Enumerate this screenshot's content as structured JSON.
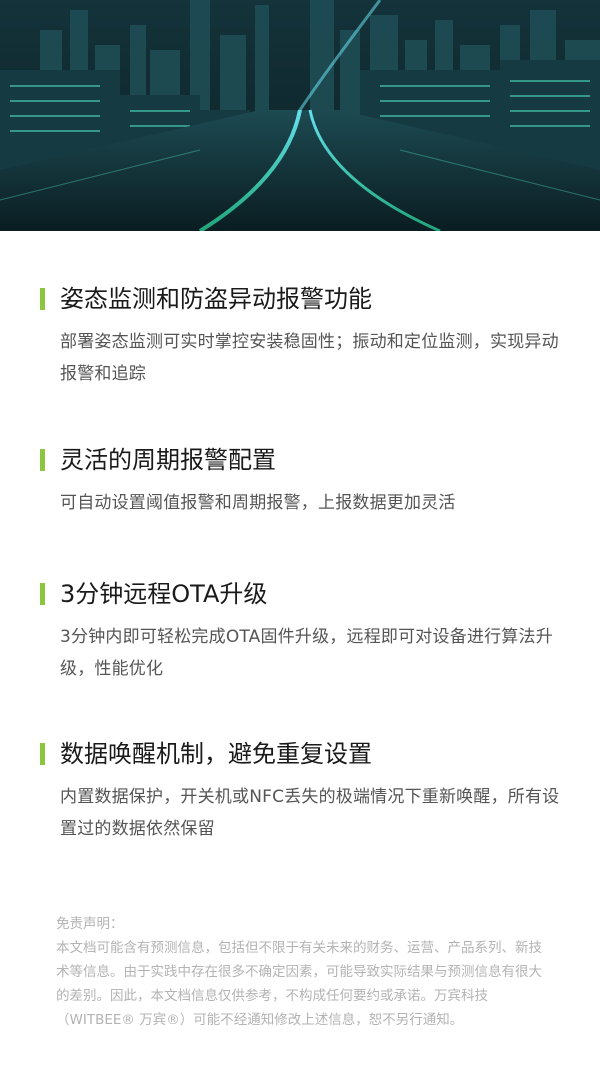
{
  "features": [
    {
      "title": "姿态监测和防盗异动报警功能",
      "description": "部署姿态监测可实时掌控安装稳固性；振动和定位监测，实现异动报警和追踪"
    },
    {
      "title": "灵活的周期报警配置",
      "description": "可自动设置阈值报警和周期报警，上报数据更加灵活"
    },
    {
      "title": "3分钟远程OTA升级",
      "description": "3分钟内即可轻松完成OTA固件升级，远程即可对设备进行算法升级，性能优化"
    },
    {
      "title": "数据唤醒机制，避免重复设置",
      "description": "内置数据保护，开关机或NFC丢失的极端情况下重新唤醒，所有设置过的数据依然保留"
    }
  ],
  "disclaimer": {
    "title": "免责声明：",
    "body": "本文档可能含有预测信息，包括但不限于有关未来的财务、运营、产品系列、新技术等信息。由于实践中存在很多不确定因素，可能导致实际结果与预测信息有很大的差别。因此，本文档信息仅供参考，不构成任何要约或承诺。万宾科技（WITBEE® 万宾®）可能不经通知修改上述信息，恕不另行通知。"
  },
  "colors": {
    "accent": "#8cc63f",
    "hero_glow": "#3fd6b0"
  }
}
